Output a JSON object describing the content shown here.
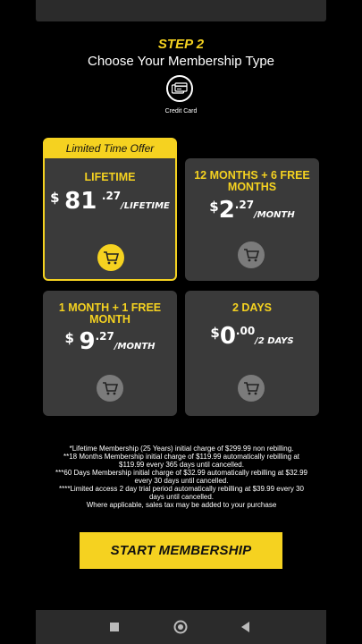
{
  "header": {
    "step": "STEP 2",
    "title": "Choose Your Membership Type",
    "payment_method_label": "Credit Card"
  },
  "plans": [
    {
      "offer": "Limited Time Offer",
      "name": "LIFETIME",
      "currency": "$",
      "amount": "81",
      "cents": ".27",
      "period": "/LIFETIME",
      "selected": true
    },
    {
      "name": "12 MONTHS + 6 FREE MONTHS",
      "currency": "$",
      "amount": "2",
      "cents": ".27",
      "period": "/MONTH",
      "selected": false
    },
    {
      "name": "1 MONTH + 1 FREE MONTH",
      "currency": "$",
      "amount": "9",
      "cents": ".27",
      "period": "/MONTH",
      "selected": false
    },
    {
      "name": "2 DAYS",
      "currency": "$",
      "amount": "0",
      "cents": ".00",
      "period": "/2 DAYS",
      "selected": false
    }
  ],
  "disclaimer": [
    "*Lifetime Membership (25 Years) initial charge of $299.99 non rebilling.",
    "**18 Months Membership initial charge of $119.99 automatically rebilling at $119.99 every 365 days until cancelled.",
    "***60 Days Membership initial charge of $32.99 automatically rebilling at $32.99 every 30 days until cancelled.",
    "****Limited access 2 day trial period automatically rebilling at $39.99 every 30 days until cancelled.",
    "Where applicable, sales tax may be added to your purchase"
  ],
  "cta": {
    "label": "START MEMBERSHIP"
  },
  "colors": {
    "accent": "#f5d220",
    "card": "#3a3a3a",
    "background": "#000000"
  },
  "icons": {
    "payment": "credit-card-icon",
    "cart": "cart-icon",
    "nav": [
      "square-icon",
      "circle-icon",
      "triangle-back-icon"
    ]
  }
}
